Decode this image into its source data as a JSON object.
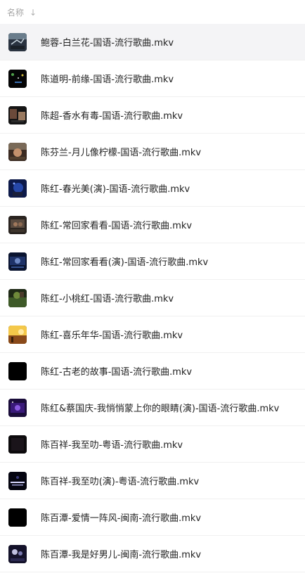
{
  "header": {
    "column_label": "名称",
    "sort_icon": "↓"
  },
  "files": [
    {
      "name": "鲍蓉-白兰花-国语-流行歌曲.mkv",
      "thumb": "t0",
      "highlighted": true
    },
    {
      "name": "陈道明-前缘-国语-流行歌曲.mkv",
      "thumb": "t1"
    },
    {
      "name": "陈超-香水有毒-国语-流行歌曲.mkv",
      "thumb": "t2"
    },
    {
      "name": "陈芬兰-月儿像柠檬-国语-流行歌曲.mkv",
      "thumb": "t3"
    },
    {
      "name": "陈红-春光美(演)-国语-流行歌曲.mkv",
      "thumb": "t4"
    },
    {
      "name": "陈红-常回家看看-国语-流行歌曲.mkv",
      "thumb": "t5"
    },
    {
      "name": "陈红-常回家看看(演)-国语-流行歌曲.mkv",
      "thumb": "t6"
    },
    {
      "name": "陈红-小桃红-国语-流行歌曲.mkv",
      "thumb": "t7"
    },
    {
      "name": "陈红-喜乐年华-国语-流行歌曲.mkv",
      "thumb": "t8"
    },
    {
      "name": "陈红-古老的故事-国语-流行歌曲.mkv",
      "thumb": "t9"
    },
    {
      "name": "陈红&蔡国庆-我悄悄蒙上你的眼睛(演)-国语-流行歌曲.mkv",
      "thumb": "t10"
    },
    {
      "name": "陈百祥-我至叻-粤语-流行歌曲.mkv",
      "thumb": "t11"
    },
    {
      "name": "陈百祥-我至叻(演)-粤语-流行歌曲.mkv",
      "thumb": "t12"
    },
    {
      "name": "陈百潭-爱情一阵风-闽南-流行歌曲.mkv",
      "thumb": "t13"
    },
    {
      "name": "陈百潭-我是好男儿-闽南-流行歌曲.mkv",
      "thumb": "t14"
    }
  ]
}
